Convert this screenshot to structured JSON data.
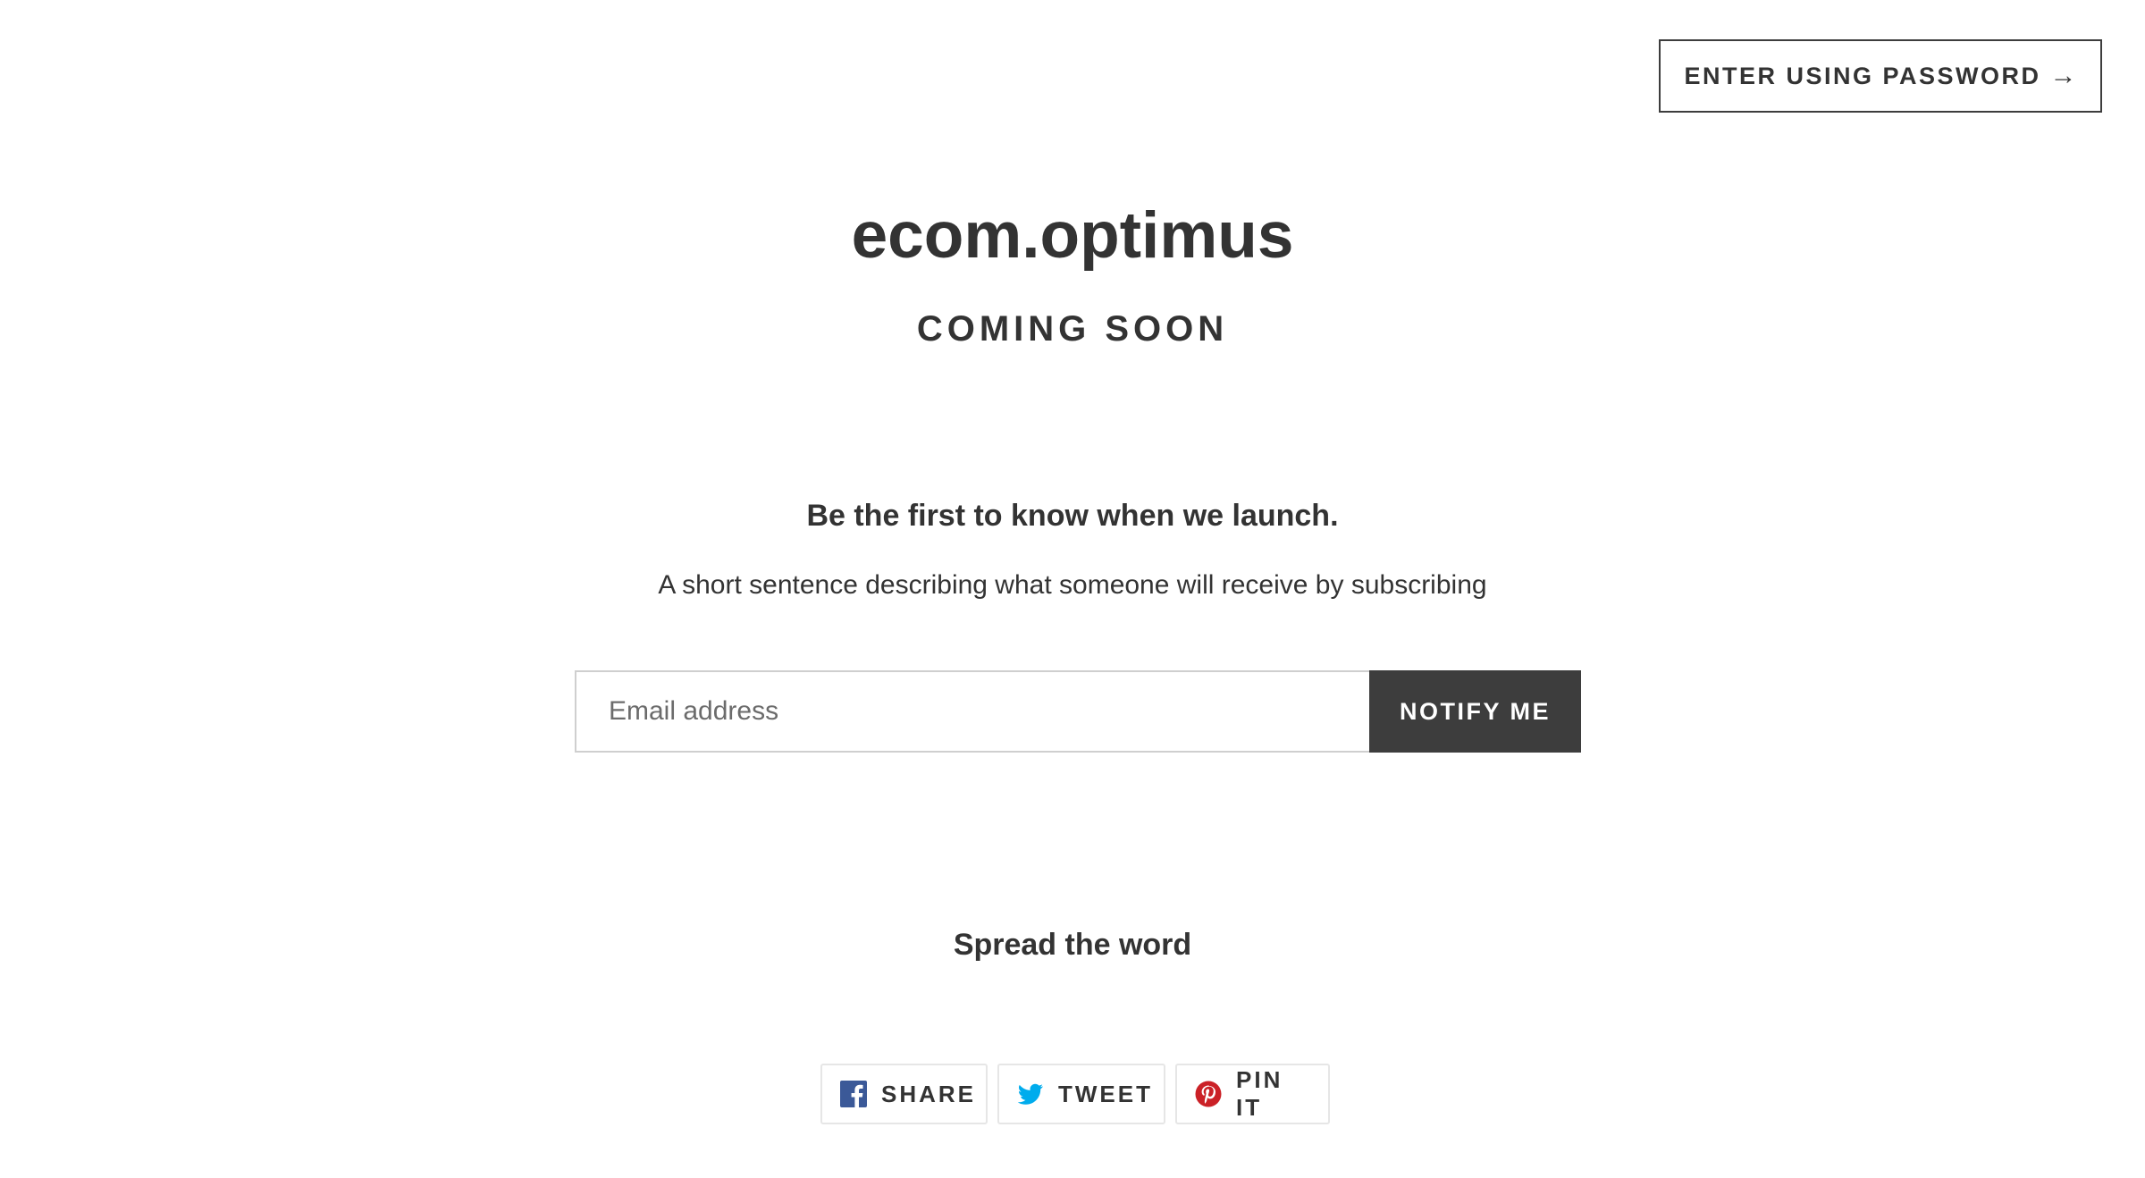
{
  "header": {
    "password_button_label": "ENTER USING PASSWORD",
    "password_button_arrow": "→"
  },
  "hero": {
    "store_name": "ecom.optimus",
    "tagline": "COMING SOON"
  },
  "newsletter": {
    "heading": "Be the first to know when we launch.",
    "description": "A short sentence describing what someone will receive by subscribing",
    "email_placeholder": "Email address",
    "email_value": "",
    "submit_label": "NOTIFY ME"
  },
  "social": {
    "heading": "Spread the word",
    "buttons": [
      {
        "label": "SHARE",
        "icon": "facebook-icon",
        "color": "#3b5998"
      },
      {
        "label": "TWEET",
        "icon": "twitter-icon",
        "color": "#00aced"
      },
      {
        "label": "PIN IT",
        "icon": "pinterest-icon",
        "color": "#cb2127"
      }
    ]
  },
  "colors": {
    "text": "#333333",
    "button_dark": "#3d3d3d",
    "background": "#ffffff"
  }
}
